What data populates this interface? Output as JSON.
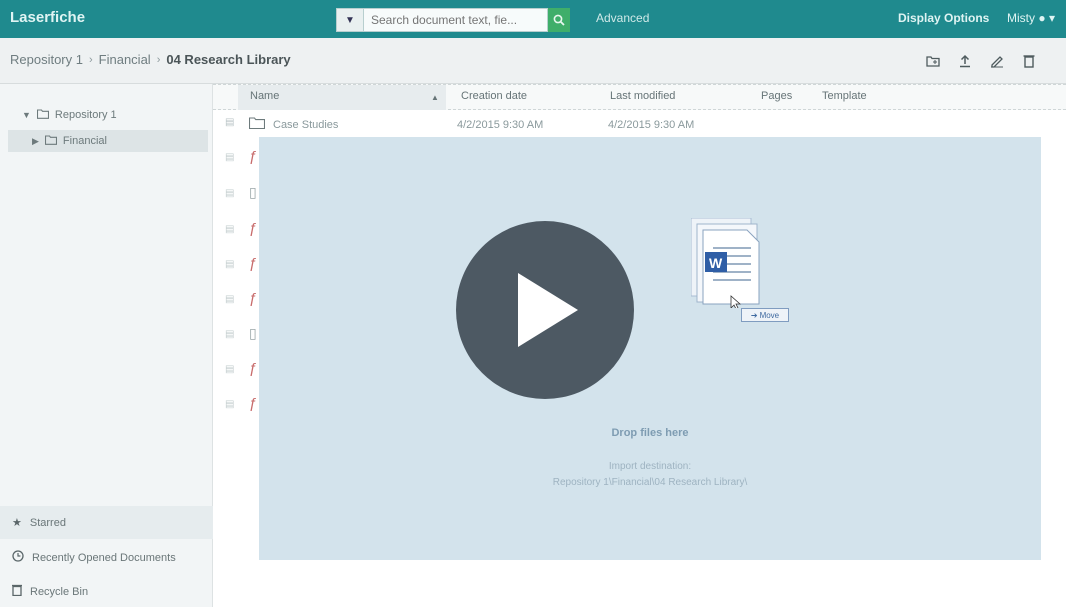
{
  "header": {
    "brand": "Laserfiche",
    "search_placeholder": "Search document text, fie...",
    "advanced_label": "Advanced",
    "display_options_label": "Display Options",
    "user_name": "Misty"
  },
  "breadcrumb": {
    "items": [
      "Repository 1",
      "Financial"
    ],
    "current": "04 Research Library"
  },
  "toolbar": {
    "icons": [
      "new-folder-icon",
      "upload-icon",
      "edit-icon",
      "delete-icon",
      "more-icon"
    ]
  },
  "tree": {
    "root_label": "Repository 1",
    "child_label": "Financial"
  },
  "sidebar_bottom": {
    "starred": "Starred",
    "recent": "Recently Opened Documents",
    "recycle": "Recycle Bin"
  },
  "table": {
    "columns": {
      "name": "Name",
      "created": "Creation date",
      "modified": "Last modified",
      "pages": "Pages",
      "template": "Template"
    },
    "first_row": {
      "name": "Case Studies",
      "created": "4/2/2015 9:30 AM",
      "modified": "4/2/2015 9:30 AM"
    }
  },
  "dropzone": {
    "title": "Drop files here",
    "import_label": "Import destination:",
    "import_path": "Repository 1\\Financial\\04 Research Library\\"
  },
  "drag": {
    "move_label": "Move"
  },
  "colors": {
    "topbar": "#1f8a8e",
    "search_button": "#3fae6a",
    "dropzone": "#d3e3ec",
    "play_button": "#4d5963"
  }
}
